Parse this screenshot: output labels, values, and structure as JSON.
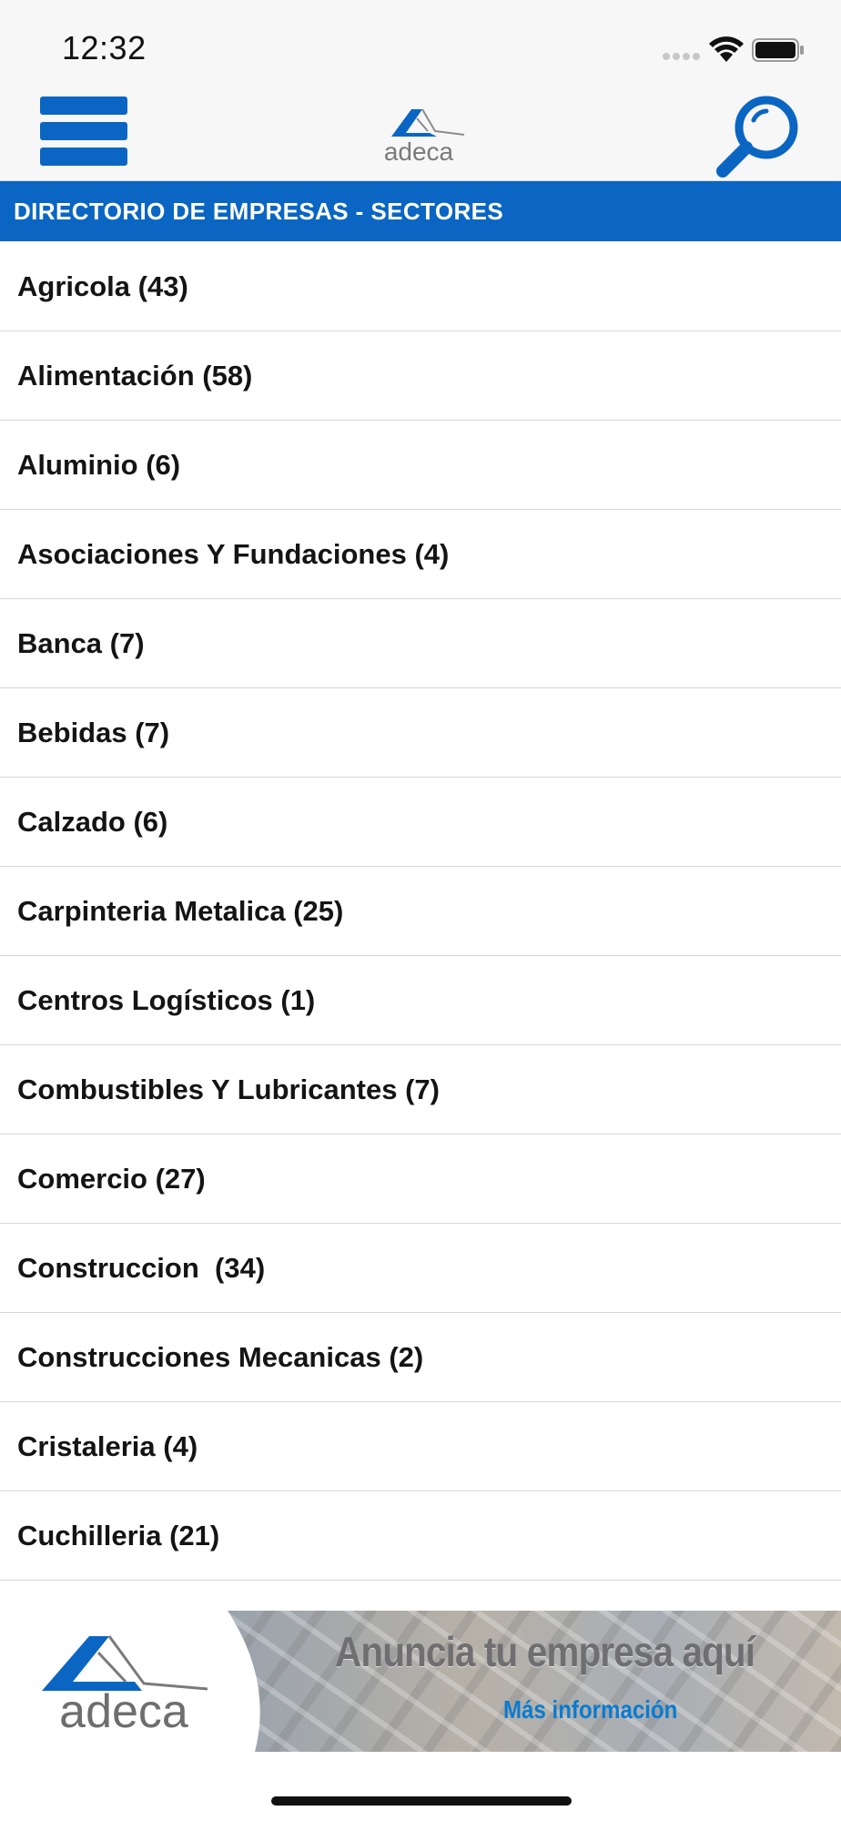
{
  "status_bar": {
    "time": "12:32"
  },
  "nav": {
    "logo_text": "adeca"
  },
  "section": {
    "title": "DIRECTORIO DE EMPRESAS - SECTORES"
  },
  "sectors": [
    "Agricola (43)",
    "Alimentación (58)",
    "Aluminio (6)",
    "Asociaciones Y Fundaciones (4)",
    "Banca (7)",
    "Bebidas (7)",
    "Calzado (6)",
    "Carpinteria Metalica (25)",
    "Centros Logísticos (1)",
    "Combustibles Y Lubricantes (7)",
    "Comercio (27)",
    "Construccion  (34)",
    "Construcciones Mecanicas (2)",
    "Cristaleria (4)",
    "Cuchilleria (21)"
  ],
  "banner": {
    "logo_text": "adeca",
    "title": "Anuncia tu empresa aquí",
    "link": "Más información"
  },
  "colors": {
    "brand_blue": "#0a66c2",
    "nav_background": "#f7f7f7"
  },
  "icons": {
    "menu": "hamburger-menu-icon",
    "search": "magnifying-glass-icon"
  }
}
